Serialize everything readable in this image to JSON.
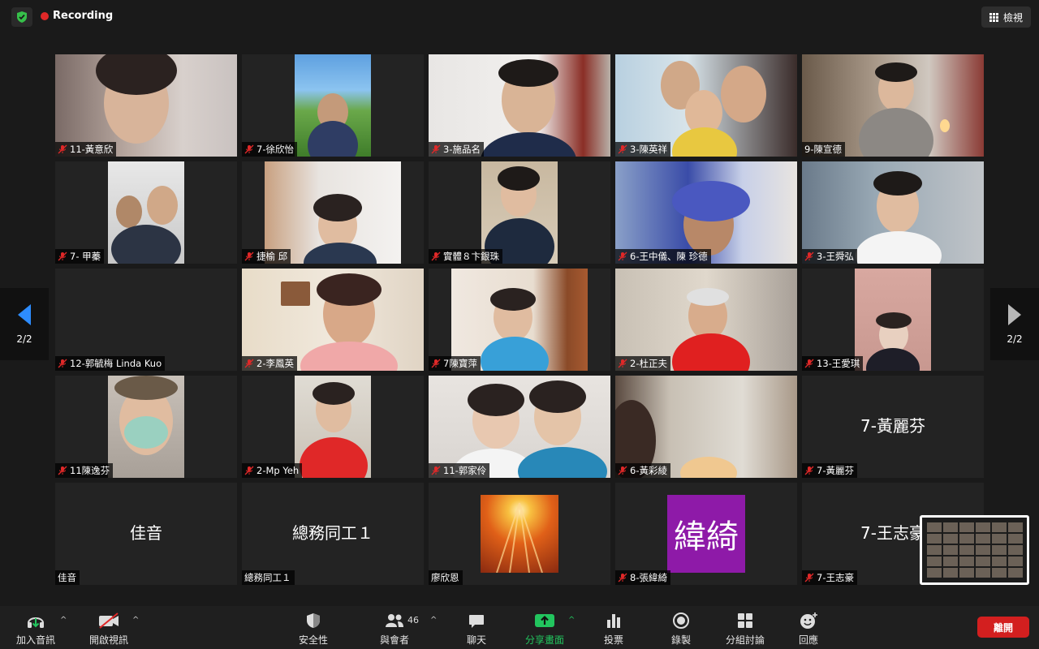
{
  "top_bar": {
    "recording_label": "Recording",
    "view_label": "檢視",
    "shield_color": "#36c04a",
    "recording_color": "#e02828"
  },
  "participants": [
    {
      "name": "11-黃意欣",
      "muted": true,
      "video": true
    },
    {
      "name": "7-徐欣怡",
      "muted": true,
      "video": true
    },
    {
      "name": "3-施品名",
      "muted": true,
      "video": true
    },
    {
      "name": "3-陳英祥",
      "muted": true,
      "video": true
    },
    {
      "name": "9-陳宣德",
      "muted": false,
      "video": true
    },
    {
      "name": "7- 甲蓁",
      "muted": true,
      "video": true
    },
    {
      "name": "捷榆 邱",
      "muted": true,
      "video": true
    },
    {
      "name": "實體８卞銀珠",
      "muted": true,
      "video": true
    },
    {
      "name": "6-王中儀、陳 珍德",
      "muted": true,
      "video": true
    },
    {
      "name": "3-王舜弘",
      "muted": true,
      "video": true
    },
    {
      "name": "12-郭毓梅 Linda Kuo",
      "muted": true,
      "video": false
    },
    {
      "name": "2-李鳳英",
      "muted": true,
      "video": true
    },
    {
      "name": "7陳寶萍",
      "muted": true,
      "video": true
    },
    {
      "name": "2-杜正夫",
      "muted": true,
      "video": true
    },
    {
      "name": "13-王愛琪",
      "muted": true,
      "video": true
    },
    {
      "name": "11陳逸芬",
      "muted": true,
      "video": true
    },
    {
      "name": "2-Mp Yeh",
      "muted": true,
      "video": true
    },
    {
      "name": "11-郭家伶",
      "muted": true,
      "video": true
    },
    {
      "name": "6-黃彩綾",
      "muted": true,
      "video": true
    },
    {
      "name": "7-黃麗芬",
      "muted": true,
      "video": false,
      "display_name": "7-黃麗芬"
    },
    {
      "name": "佳音",
      "muted": false,
      "video": false,
      "display_name": "佳音"
    },
    {
      "name": "總務同工１",
      "muted": false,
      "video": false,
      "display_name": "總務同工１"
    },
    {
      "name": "廖欣恩",
      "muted": false,
      "video": false,
      "avatar": "sunset"
    },
    {
      "name": "8-張緯綺",
      "muted": true,
      "video": false,
      "avatar_text": "緯綺"
    },
    {
      "name": "7-王志豪",
      "muted": true,
      "video": false,
      "display_name": "7-王志豪"
    }
  ],
  "pagination": {
    "label": "2/2",
    "arrow_color": "#2d8cff"
  },
  "toolbar": {
    "audio_label": "加入音訊",
    "video_label": "開啟視訊",
    "security_label": "安全性",
    "participants_label": "與會者",
    "participants_count": "46",
    "chat_label": "聊天",
    "share_label": "分享畫面",
    "poll_label": "投票",
    "record_label": "錄製",
    "breakout_label": "分組討論",
    "reactions_label": "回應",
    "leave_label": "離開",
    "share_color": "#22c55e",
    "leave_color": "#d31f1f"
  }
}
